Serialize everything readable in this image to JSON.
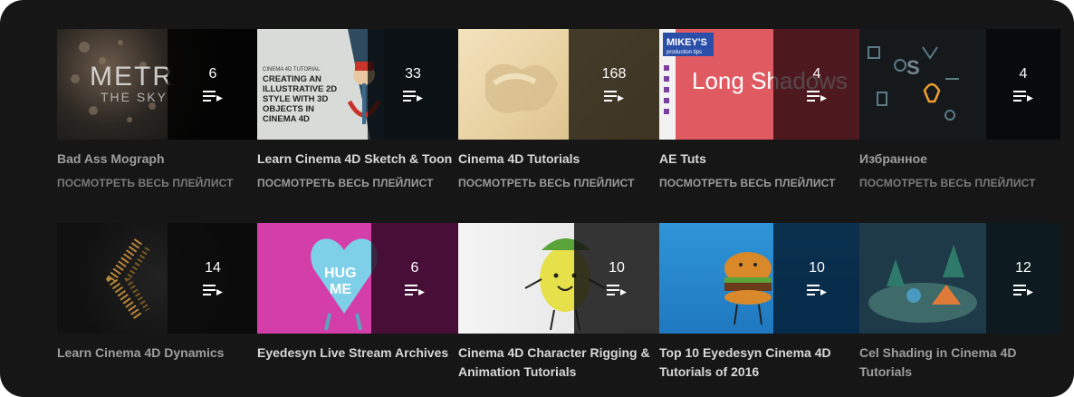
{
  "common": {
    "view_all": "ПОСМОТРЕТЬ ВЕСЬ ПЛЕЙЛИСТ"
  },
  "playlists": [
    {
      "title": "Bad Ass Mograph",
      "count": "6",
      "show_view_all": true,
      "thumb": {
        "big": "METR",
        "small": "THE SKY"
      }
    },
    {
      "title": "Learn Cinema 4D Sketch & Toon",
      "count": "33",
      "show_view_all": true,
      "thumb": {
        "small": "CINEMA 4D TUTORIAL",
        "lines": [
          "CREATING AN",
          "ILLUSTRATIVE 2D",
          "STYLE WITH 3D",
          "OBJECTS IN",
          "CINEMA 4D"
        ]
      }
    },
    {
      "title": "Cinema 4D Tutorials",
      "count": "168",
      "show_view_all": true,
      "thumb": {}
    },
    {
      "title": "AE Tuts",
      "count": "4",
      "show_view_all": true,
      "thumb": {
        "brand": "MIKEY'S",
        "brand_sub": "production tips",
        "headline": "Long Shadows"
      }
    },
    {
      "title": "Избранное",
      "count": "4",
      "show_view_all": true,
      "thumb": {}
    },
    {
      "title": "Learn Cinema 4D Dynamics",
      "count": "14",
      "show_view_all": false,
      "thumb": {}
    },
    {
      "title": "Eyedesyn Live Stream Archives",
      "count": "6",
      "show_view_all": false,
      "thumb": {
        "heart_line1": "HUG",
        "heart_line2": "ME"
      }
    },
    {
      "title": "Cinema 4D Character Rigging & Animation Tutorials",
      "count": "10",
      "show_view_all": false,
      "thumb": {}
    },
    {
      "title": "Top 10 Eyedesyn Cinema 4D Tutorials of 2016",
      "count": "10",
      "show_view_all": false,
      "thumb": {}
    },
    {
      "title": "Cel Shading in Cinema 4D Tutorials",
      "count": "12",
      "show_view_all": false,
      "thumb": {}
    }
  ],
  "colors": {
    "background": "#161616",
    "title_text": "#d8d8d8",
    "subtext": "#9b9b9b",
    "overlay": "rgba(0,0,0,0.78)"
  },
  "icons": {
    "playlist": "playlist-play-icon"
  }
}
